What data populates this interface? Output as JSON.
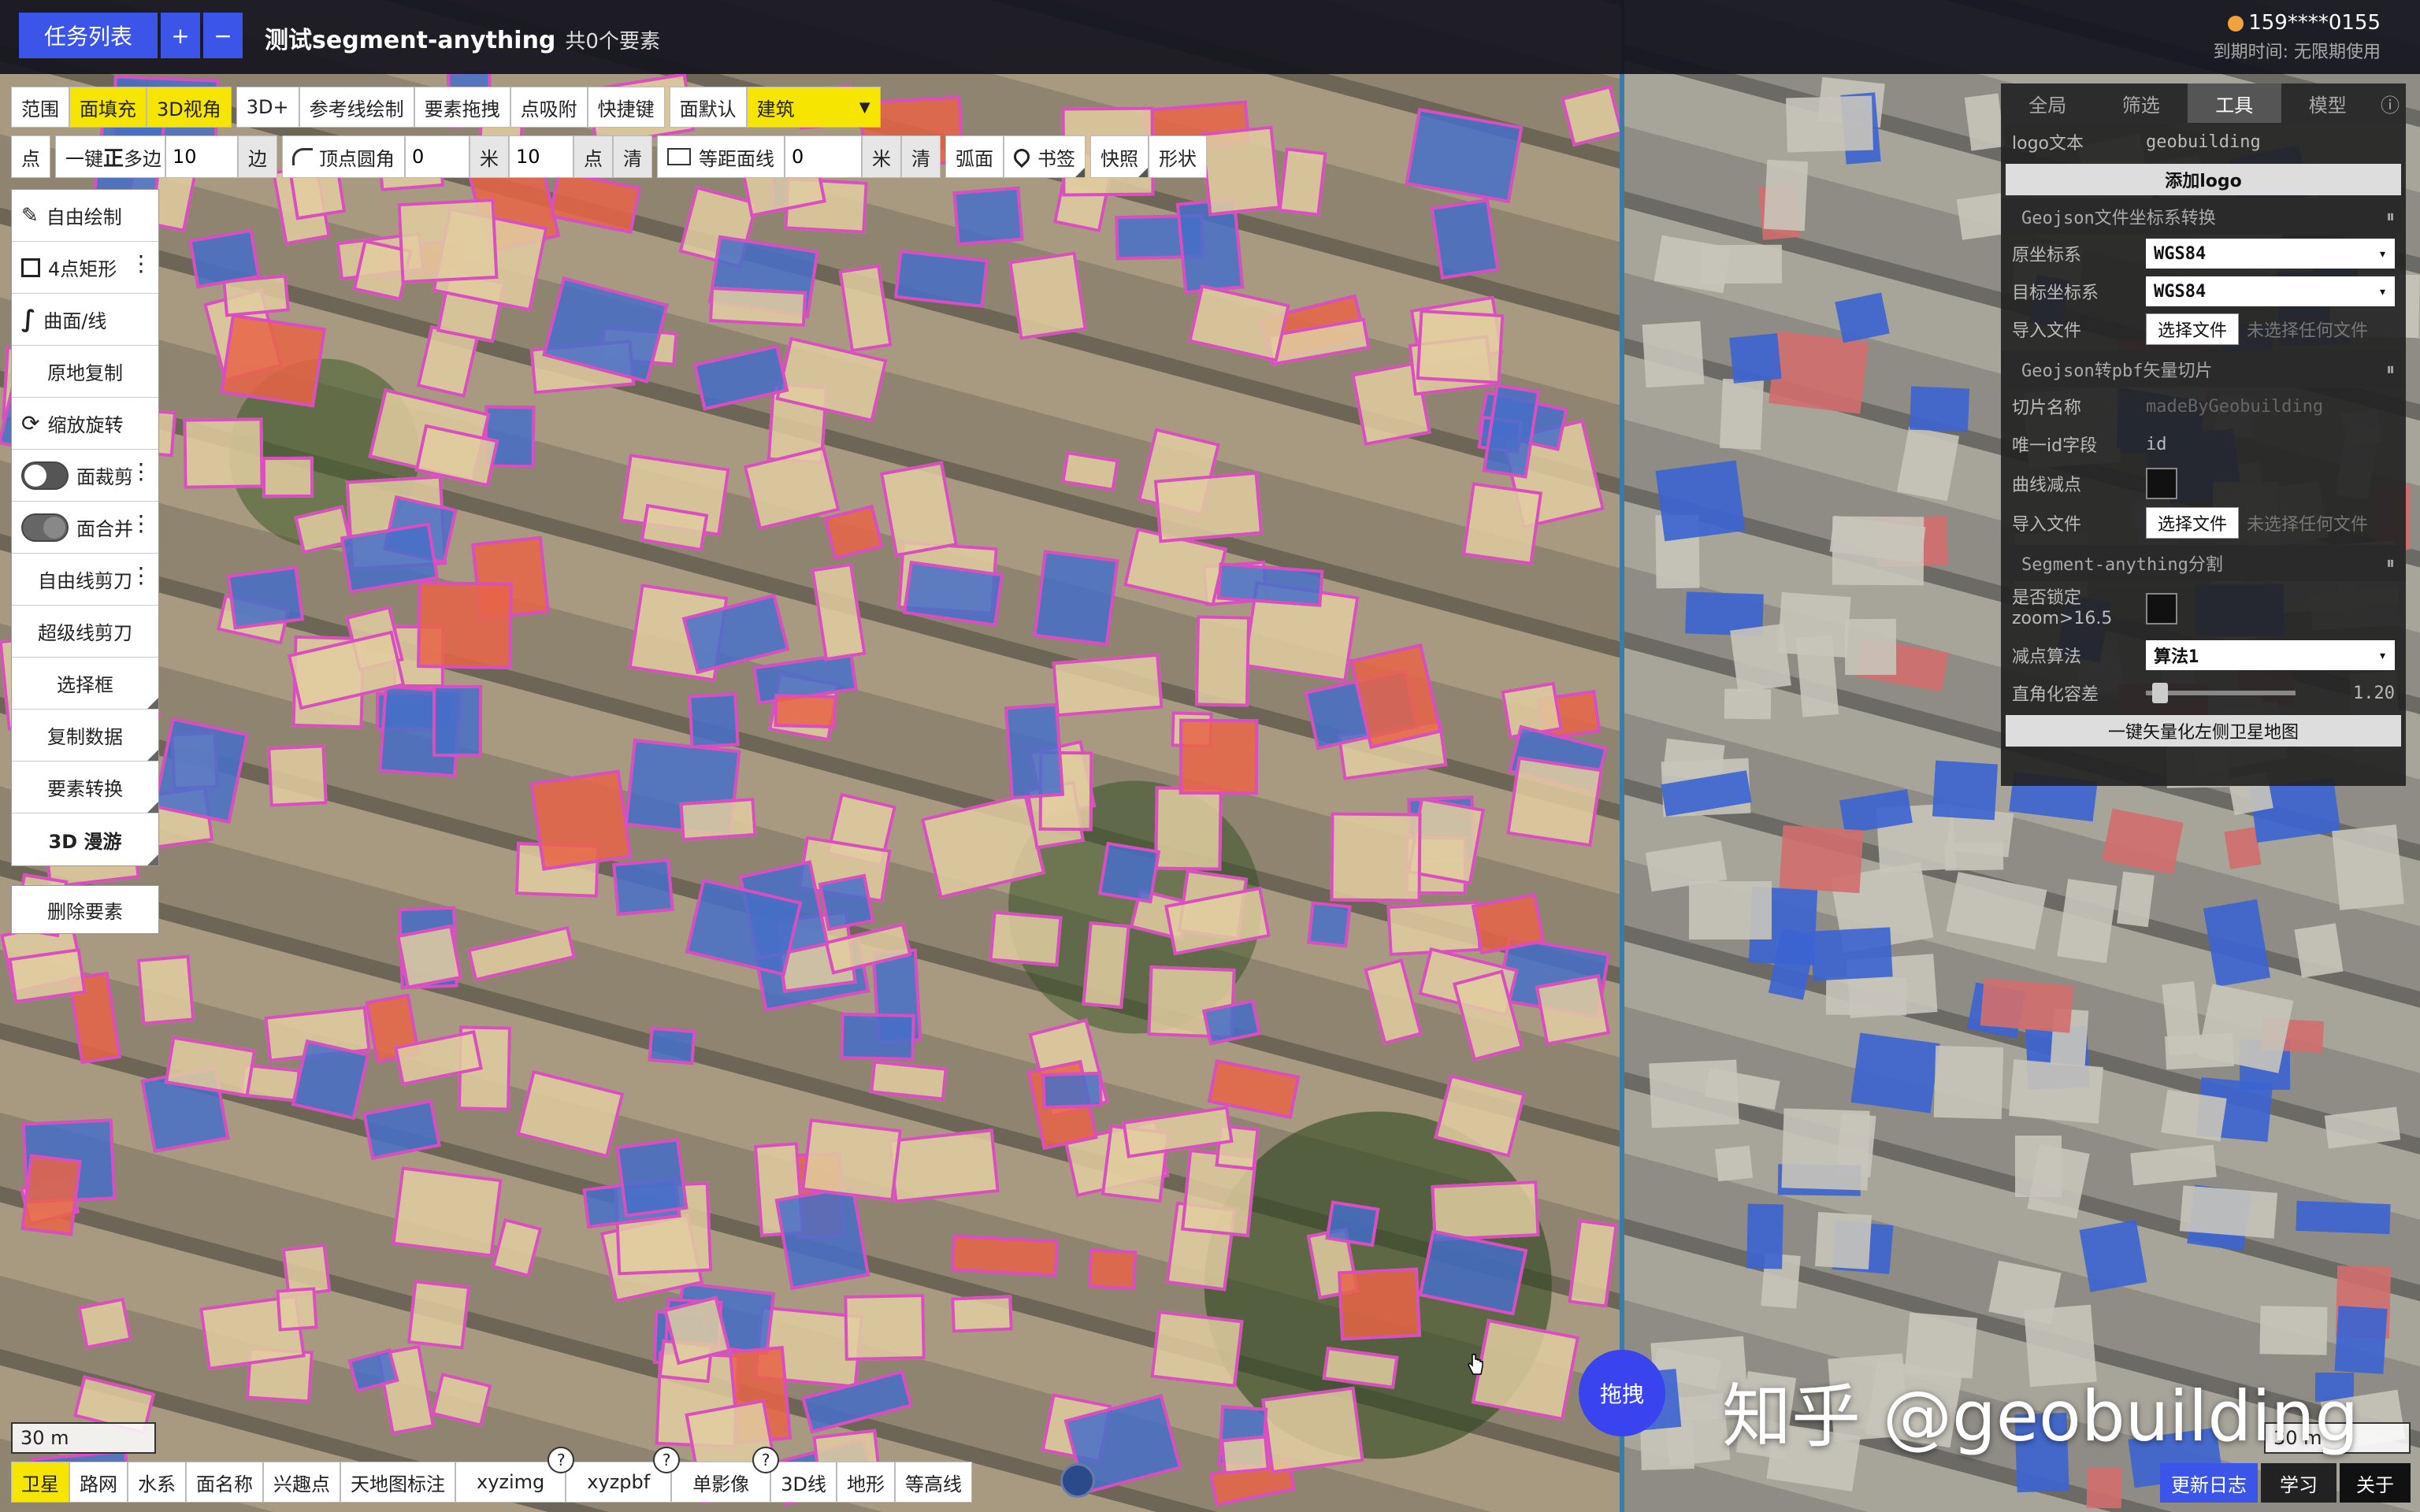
{
  "header": {
    "task_list_label": "任务列表",
    "add_label": "+",
    "remove_label": "−",
    "title": "测试segment-anything",
    "feature_count": "共0个要素",
    "user": "159****0155",
    "expire": "到期时间: 无限期使用"
  },
  "toolbar1": {
    "range": "范围",
    "face_fill": "面填充",
    "view_3d": "3D视角",
    "plus_3d": "3D+",
    "ref_line": "参考线绘制",
    "drag_feature": "要素拖拽",
    "snap": "点吸附",
    "shortcut": "快捷键",
    "face_default": "面默认",
    "category_selected": "建筑"
  },
  "toolbar2": {
    "point": "点",
    "one_key": "一键",
    "regular": "正",
    "polygon": "多边",
    "sides_value": "10",
    "sides_unit": "边",
    "vertex_round": "顶点圆角",
    "round_value": "0",
    "meter": "米",
    "points_value": "10",
    "points_unit": "点",
    "clear": "清",
    "equidistant": "等距面线",
    "equi_value": "0",
    "equi_meter": "米",
    "equi_clear": "清",
    "arc": "弧面",
    "bookmark": "书签",
    "snapshot": "快照",
    "shape": "形状"
  },
  "left_tools": {
    "free_draw": "自由绘制",
    "rect4": "4点矩形",
    "curve": "曲面/线",
    "copy_in_place": "原地复制",
    "scale_rotate": "缩放旋转",
    "face_clip": "面裁剪",
    "face_merge": "面合并",
    "free_cut": "自由线剪刀",
    "super_cut": "超级线剪刀",
    "select_box": "选择框",
    "copy_data": "复制数据",
    "convert": "要素转换",
    "roam_3d": "3D 漫游",
    "delete": "删除要素"
  },
  "panel": {
    "tabs": [
      "全局",
      "筛选",
      "工具",
      "模型",
      "ⓘ"
    ],
    "active_tab": "工具",
    "logo_text_label": "logo文本",
    "logo_text_value": "geobuilding",
    "add_logo": "添加logo",
    "sec_geojson_crs": "Geojson文件坐标系转换",
    "src_crs_label": "原坐标系",
    "src_crs_value": "WGS84",
    "dst_crs_label": "目标坐标系",
    "dst_crs_value": "WGS84",
    "import_label": "导入文件",
    "choose_file": "选择文件",
    "no_file": "未选择任何文件",
    "sec_pbf": "Geojson转pbf矢量切片",
    "tile_name_label": "切片名称",
    "tile_name_placeholder": "madeByGeobuilding",
    "uid_label": "唯一id字段",
    "uid_value": "id",
    "curve_reduce_label": "曲线减点",
    "import2_label": "导入文件",
    "choose_file2": "选择文件",
    "no_file2": "未选择任何文件",
    "sec_sam": "Segment-anything分割",
    "lock_zoom_label1": "是否锁定",
    "lock_zoom_label2": "zoom>16.5",
    "reduce_algo_label": "减点算法",
    "reduce_algo_value": "算法1",
    "ortho_tol_label": "直角化容差",
    "ortho_tol_value": "1.20",
    "vectorize_btn": "一键矢量化左侧卫星地图"
  },
  "bottom": {
    "scale_left": "30 m",
    "scale_right": "30 m",
    "layers": [
      "卫星",
      "路网",
      "水系",
      "面名称",
      "兴趣点",
      "天地图标注",
      "xyzimg",
      "xyzpbf",
      "单影像",
      "3D线",
      "地形",
      "等高线"
    ],
    "help": "?",
    "drag": "拖拽",
    "watermark": "知乎 @geobuilding",
    "changelog": "更新日志",
    "learn": "学习",
    "about": "关于"
  },
  "colors": {
    "accent_blue": "#3a55e8",
    "highlight_yellow": "#f5e500",
    "outline_pink": "#d94fbf"
  }
}
